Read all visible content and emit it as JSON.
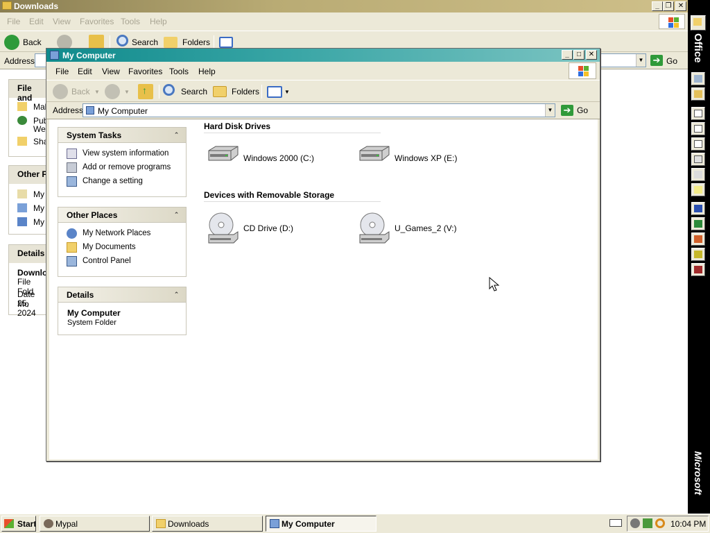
{
  "background_window": {
    "title": "Downloads",
    "menu": [
      "File",
      "Edit",
      "View",
      "Favorites",
      "Tools",
      "Help"
    ],
    "toolbar": {
      "back": "Back",
      "search": "Search",
      "folders": "Folders"
    },
    "address_label": "Address",
    "go_label": "Go",
    "panels": [
      {
        "head": "File and",
        "items": [
          "Mak",
          "Pub",
          "We",
          "Sha"
        ]
      },
      {
        "head": "Other F",
        "items": [
          "My",
          "My",
          "My"
        ]
      },
      {
        "head": "Details",
        "title": "Downlo",
        "subtitle": "File Fold",
        "date_label": "Date Mo",
        "date_value": "25, 2024"
      }
    ]
  },
  "window": {
    "title": "My Computer",
    "menu": [
      "File",
      "Edit",
      "View",
      "Favorites",
      "Tools",
      "Help"
    ],
    "toolbar": {
      "back": "Back",
      "search": "Search",
      "folders": "Folders"
    },
    "address_label": "Address",
    "address_value": "My Computer",
    "go_label": "Go",
    "system_tasks": {
      "title": "System Tasks",
      "items": [
        "View system information",
        "Add or remove programs",
        "Change a setting"
      ]
    },
    "other_places": {
      "title": "Other Places",
      "items": [
        "My Network Places",
        "My Documents",
        "Control Panel"
      ]
    },
    "details": {
      "title": "Details",
      "name": "My Computer",
      "type": "System Folder"
    },
    "groups": {
      "hard_disks": {
        "title": "Hard Disk Drives",
        "items": [
          "Windows 2000 (C:)",
          "Windows XP (E:)"
        ]
      },
      "removable": {
        "title": "Devices with Removable Storage",
        "items": [
          "CD Drive (D:)",
          "U_Games_2 (V:)"
        ]
      }
    }
  },
  "office_bar": {
    "top_label": "Office",
    "bottom_label": "Microsoft"
  },
  "taskbar": {
    "start": "Start",
    "buttons": [
      "Mypal",
      "Downloads",
      "My Computer"
    ],
    "active": "My Computer",
    "clock": "10:04 PM"
  },
  "colors": {
    "title_active": "#0f8a8c",
    "title_inactive": "#b9ab74",
    "window_face": "#ece9d8"
  }
}
